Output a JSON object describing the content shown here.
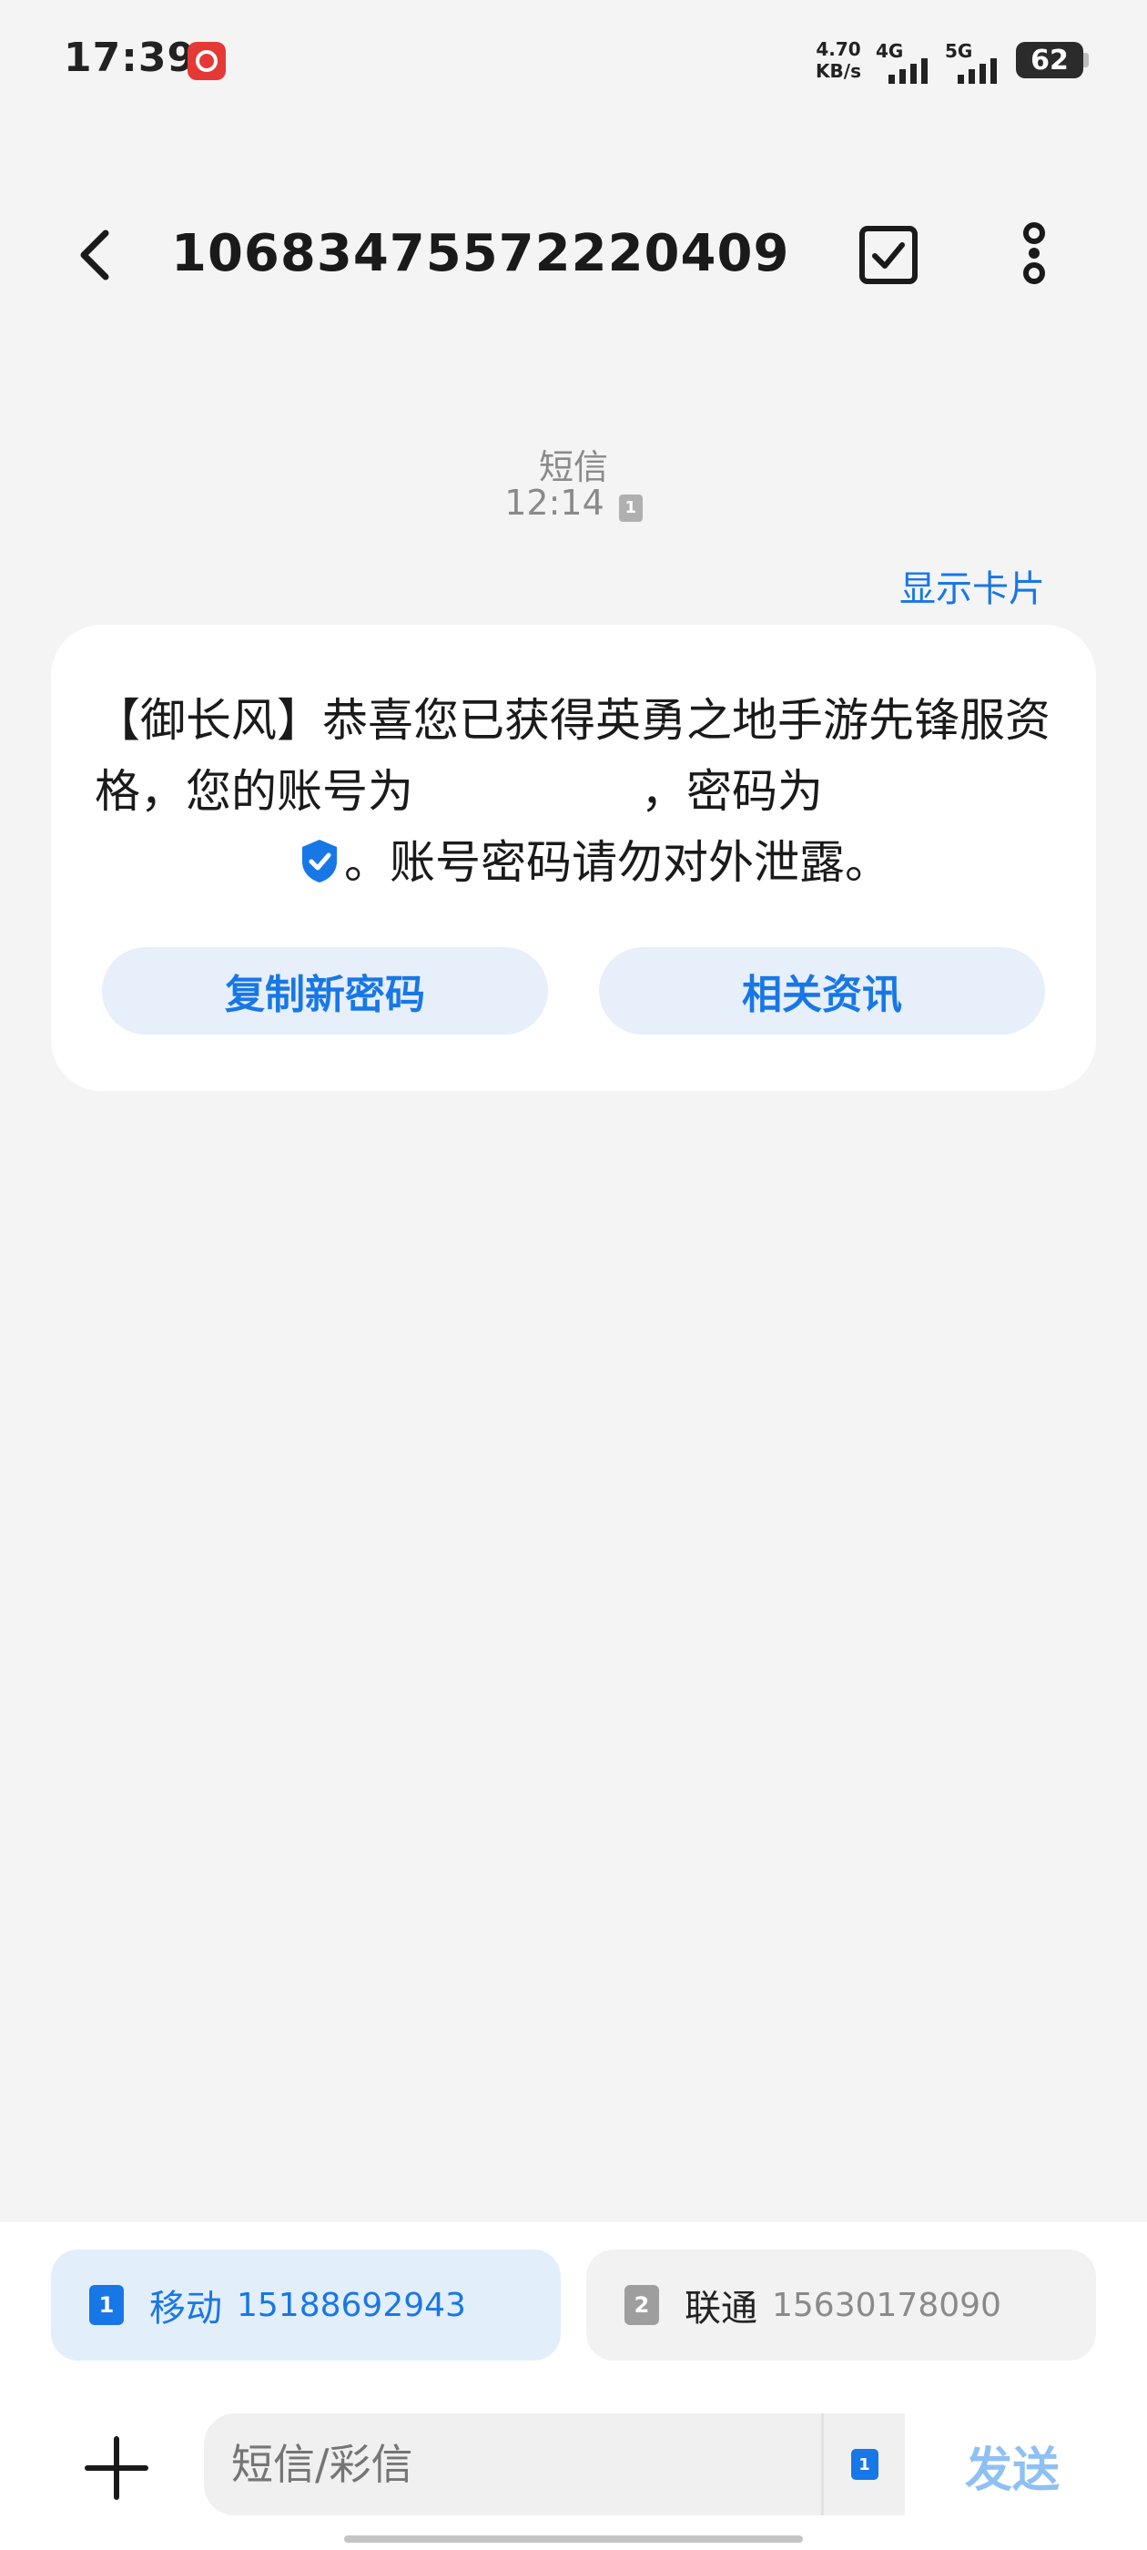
{
  "status_bar": {
    "time": "17:39",
    "speed_value": "4.70",
    "speed_unit": "KB/s",
    "network1": "4G",
    "network2": "5G",
    "battery": "62"
  },
  "header": {
    "title": "10683475572220409",
    "back_icon": "chevron-left-icon",
    "select_icon": "checkbox-icon",
    "more_icon": "more-vertical-icon"
  },
  "message_meta": {
    "type": "短信",
    "time": "12:14",
    "sim": "1",
    "show_card": "显示卡片"
  },
  "message": {
    "part1": "【御长风】恭喜您已获得英勇之地手游先锋服资格，您的账号为",
    "part2": "，密码为",
    "part3": "。账号密码请勿对外泄露。",
    "actions": [
      "复制新密码",
      "相关资讯"
    ]
  },
  "sim_cards": [
    {
      "slot": "1",
      "carrier": "移动",
      "number": "15188692943"
    },
    {
      "slot": "2",
      "carrier": "联通",
      "number": "15630178090"
    }
  ],
  "composer": {
    "placeholder": "短信/彩信",
    "sim_slot": "1",
    "send_label": "发送"
  },
  "colors": {
    "accent": "#1877e6",
    "background": "#f4f4f4",
    "bubble": "#ffffff",
    "button_bg": "#e6effa"
  }
}
